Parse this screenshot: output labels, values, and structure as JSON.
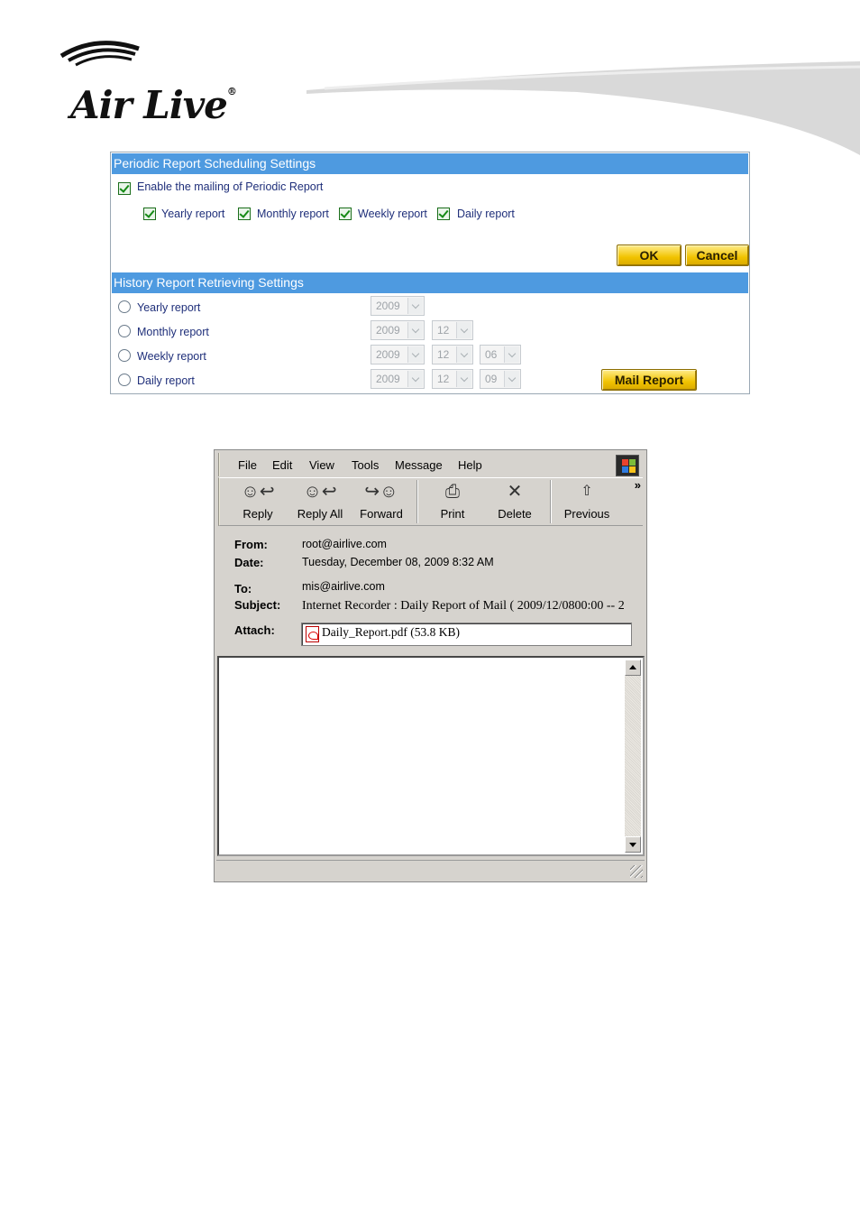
{
  "brand": {
    "name": "Air Live",
    "mark": "®"
  },
  "colors": {
    "section_bar": "#4e9ae0",
    "label_text": "#1f2f7a",
    "button_gold": "#f1c300"
  },
  "periodic": {
    "title": "Periodic Report Scheduling Settings",
    "enable_label": "Enable the mailing of Periodic Report",
    "enable_checked": true,
    "options": [
      {
        "label": "Yearly report",
        "checked": true
      },
      {
        "label": "Monthly report",
        "checked": true
      },
      {
        "label": "Weekly report",
        "checked": true
      },
      {
        "label": "Daily report",
        "checked": true
      }
    ],
    "ok_label": "OK",
    "cancel_label": "Cancel"
  },
  "history": {
    "title": "History Report Retrieving Settings",
    "rows": [
      {
        "label": "Yearly report",
        "year": "2009"
      },
      {
        "label": "Monthly report",
        "year": "2009",
        "month": "12"
      },
      {
        "label": "Weekly report",
        "year": "2009",
        "month": "12",
        "day": "06"
      },
      {
        "label": "Daily report",
        "year": "2009",
        "month": "12",
        "day": "09"
      }
    ],
    "mail_report_label": "Mail Report"
  },
  "mail": {
    "menu": [
      "File",
      "Edit",
      "View",
      "Tools",
      "Message",
      "Help"
    ],
    "toolbar": [
      {
        "label": "Reply",
        "icon": "reply-icon"
      },
      {
        "label": "Reply All",
        "icon": "reply-all-icon"
      },
      {
        "label": "Forward",
        "icon": "forward-icon"
      },
      {
        "label": "Print",
        "icon": "printer-icon"
      },
      {
        "label": "Delete",
        "icon": "delete-icon"
      },
      {
        "label": "Previous",
        "icon": "up-arrow-icon"
      }
    ],
    "more_glyph": "»",
    "from_label": "From:",
    "from": "root@airlive.com",
    "date_label": "Date:",
    "date": "Tuesday, December 08, 2009 8:32 AM",
    "to_label": "To:",
    "to": "mis@airlive.com",
    "subject_label": "Subject:",
    "subject": "Internet Recorder : Daily Report of Mail ( 2009/12/0800:00 -- 2",
    "attach_label": "Attach:",
    "attachment": "Daily_Report.pdf (53.8 KB)"
  }
}
